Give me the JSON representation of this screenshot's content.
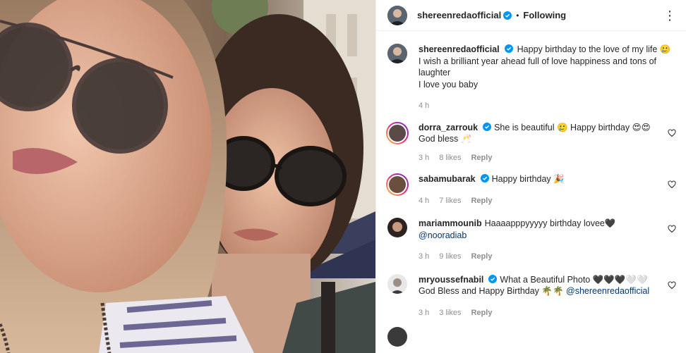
{
  "post": {
    "owner": "shereenredaofficial",
    "separator": "•",
    "follow_status": "Following",
    "more_icon": "more-horizontal-icon"
  },
  "caption": {
    "username": "shereenredaofficial",
    "lines": [
      "Happy birthday to the love of my life 🥲",
      "I wish a brilliant year ahead full of love happiness and tons of laughter",
      "I love you baby"
    ],
    "time": "4 h"
  },
  "comments": [
    {
      "username": "dorra_zarrouk",
      "text": "She is beautiful 🥲 Happy birthday 😍😍 God bless 🥂",
      "time": "3 h",
      "likes": "8 likes",
      "reply": "Reply"
    },
    {
      "username": "sabamubarak",
      "text": "Happy birthday 🎉",
      "time": "4 h",
      "likes": "7 likes",
      "reply": "Reply"
    },
    {
      "username": "mariammounib",
      "text": "Haaaapppyyyyy birthday lovee🖤",
      "mention": "@nooradiab",
      "time": "3 h",
      "likes": "9 likes",
      "reply": "Reply"
    },
    {
      "username": "mryoussefnabil",
      "text": "What a Beautiful Photo 🖤🖤🖤🤍🤍 God Bless and Happy Birthday 🌴🌴",
      "mention": "@shereenredaofficial",
      "time": "3 h",
      "likes": "3 likes",
      "reply": "Reply"
    }
  ],
  "colors": {
    "verified": "#0095f6",
    "text": "#262626",
    "muted": "#8e8e8e",
    "link": "#00376b"
  }
}
